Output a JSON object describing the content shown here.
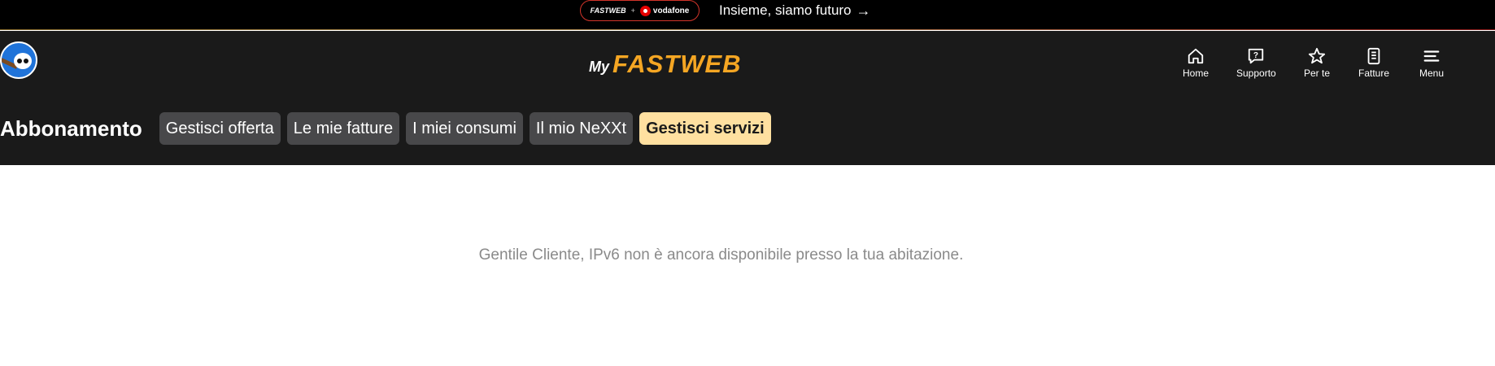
{
  "promo": {
    "brand_left": "FASTWEB",
    "plus": "+",
    "brand_right": "vodafone",
    "link_text": "Insieme, siamo futuro",
    "link_arrow": "→"
  },
  "header": {
    "logo_my": "My",
    "logo_brand": "FASTWEB",
    "nav": [
      {
        "label": "Home",
        "icon": "home-icon"
      },
      {
        "label": "Supporto",
        "icon": "help-icon"
      },
      {
        "label": "Per te",
        "icon": "star-icon"
      },
      {
        "label": "Fatture",
        "icon": "invoice-icon"
      },
      {
        "label": "Menu",
        "icon": "menu-icon"
      }
    ]
  },
  "subnav": {
    "title": "Abbonamento",
    "tabs": [
      {
        "label": "Gestisci offerta",
        "active": false
      },
      {
        "label": "Le mie fatture",
        "active": false
      },
      {
        "label": "I miei consumi",
        "active": false
      },
      {
        "label": "Il mio NeXXt",
        "active": false
      },
      {
        "label": "Gestisci servizi",
        "active": true
      }
    ]
  },
  "main": {
    "message": "Gentile Cliente, IPv6 non è ancora disponibile presso la tua abitazione."
  },
  "colors": {
    "header_bg": "#1a1a1a",
    "brand_accent": "#f5a623",
    "active_tab_bg": "#ffe0a0",
    "tab_bg": "#48484a"
  }
}
